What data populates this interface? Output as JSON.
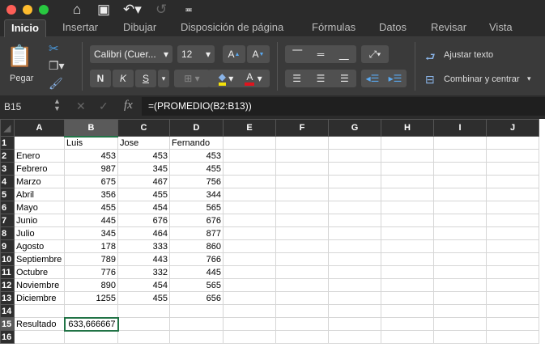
{
  "titlebar": {
    "icons": [
      "home-icon",
      "save-icon",
      "undo-icon",
      "redo-icon",
      "customize-icon"
    ]
  },
  "tabs": [
    "Inicio",
    "Insertar",
    "Dibujar",
    "Disposición de página",
    "Fórmulas",
    "Datos",
    "Revisar",
    "Vista"
  ],
  "ribbon": {
    "paste_label": "Pegar",
    "font_name": "Calibri (Cuer...",
    "font_size": "12",
    "bold": "N",
    "italic": "K",
    "underline": "S",
    "wrap_text": "Ajustar texto",
    "merge_center": "Combinar y centrar",
    "fill_color": "#f5e20a",
    "font_color": "#e0141e"
  },
  "formula_bar": {
    "name_box": "B15",
    "fx": "fx",
    "formula": "=(PROMEDIO(B2:B13))"
  },
  "sheet": {
    "columns": [
      "A",
      "B",
      "C",
      "D",
      "E",
      "F",
      "G",
      "H",
      "I",
      "J"
    ],
    "rows": [
      [
        "",
        "Luis",
        "Jose",
        "Fernando"
      ],
      [
        "Enero",
        "453",
        "453",
        "453"
      ],
      [
        "Febrero",
        "987",
        "345",
        "455"
      ],
      [
        "Marzo",
        "675",
        "467",
        "756"
      ],
      [
        "Abril",
        "356",
        "455",
        "344"
      ],
      [
        "Mayo",
        "455",
        "454",
        "565"
      ],
      [
        "Junio",
        "445",
        "676",
        "676"
      ],
      [
        "Julio",
        "345",
        "464",
        "877"
      ],
      [
        "Agosto",
        "178",
        "333",
        "860"
      ],
      [
        "Septiembre",
        "789",
        "443",
        "766"
      ],
      [
        "Octubre",
        "776",
        "332",
        "445"
      ],
      [
        "Noviembre",
        "890",
        "454",
        "565"
      ],
      [
        "Diciembre",
        "1255",
        "455",
        "656"
      ],
      [
        "",
        "",
        "",
        ""
      ],
      [
        "Resultado",
        "633,666667",
        "",
        ""
      ],
      [
        "",
        "",
        "",
        ""
      ]
    ],
    "active_cell": "B15",
    "accent": "#217346"
  }
}
